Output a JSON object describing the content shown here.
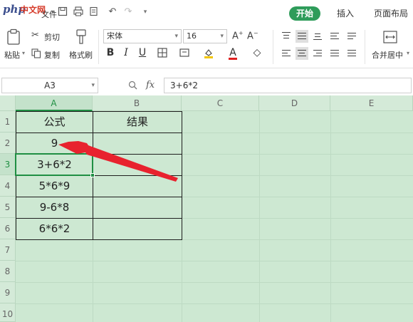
{
  "logo": {
    "php": "php",
    "cn": "中文网"
  },
  "menu": {
    "file": "文件"
  },
  "tabs": {
    "home": "开始",
    "insert": "插入",
    "page_layout": "页面布局"
  },
  "ribbon": {
    "paste": "粘贴",
    "cut": "剪切",
    "copy": "复制",
    "format_painter": "格式刷",
    "font_name": "宋体",
    "font_size": "16",
    "merge_center": "合并居中"
  },
  "formula_bar": {
    "name_box": "A3",
    "fx": "fx",
    "formula": "3+6*2"
  },
  "columns": [
    "A",
    "B",
    "C",
    "D",
    "E"
  ],
  "rows": [
    "1",
    "2",
    "3",
    "4",
    "5",
    "6",
    "7",
    "8",
    "9",
    "10"
  ],
  "table": {
    "header_formula": "公式",
    "header_result": "结果",
    "a2": "9",
    "formulas": [
      "3+6*2",
      "5*6*9",
      "9-6*8",
      "6*6*2"
    ]
  },
  "colors": {
    "accent": "#2e9c5a",
    "grid_bg": "#cde8d2",
    "arrow": "#e8222e",
    "selection": "#1f8f43"
  },
  "icons": [
    "undo-icon",
    "redo-icon",
    "save-icon",
    "print-icon",
    "search-zoom-icon",
    "fx-icon"
  ]
}
